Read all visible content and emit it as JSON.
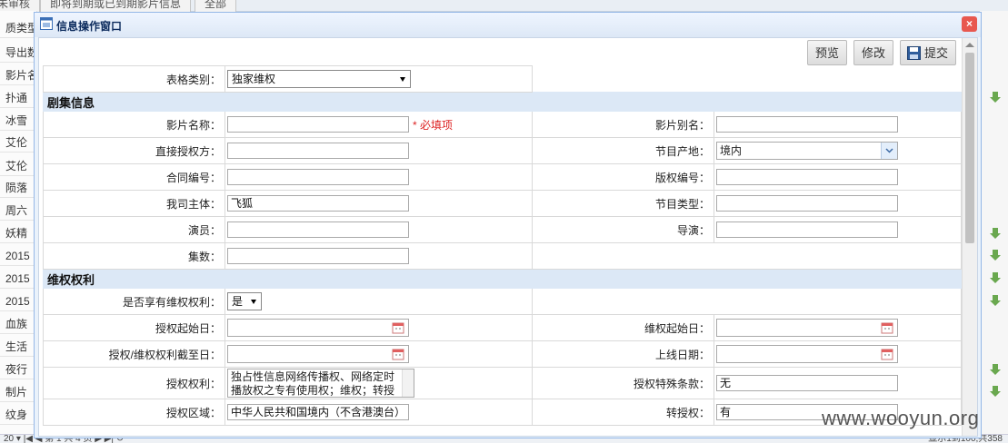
{
  "background": {
    "tabs": [
      "未审核",
      "即将到期或已到期影片信息",
      "全部"
    ],
    "left_rows": [
      "质类型",
      "导出数",
      "影片名",
      "扑通",
      "冰雪",
      "艾伦",
      "艾伦",
      "陨落",
      "周六",
      "妖精",
      "2015",
      "2015",
      "2015",
      "血族",
      "生活",
      "夜行",
      "制片",
      "纹身"
    ],
    "pager_left": "20 ▾  |◀  ◀  第 1  共 4 页  ▶  ▶|  ↻",
    "pager_right": "显示1到100,共358"
  },
  "dialog": {
    "title": "信息操作窗口",
    "close_icon": "×",
    "toolbar": {
      "preview": "预览",
      "edit": "修改",
      "submit": "提交"
    },
    "form": {
      "table_type_label": "表格类别：",
      "table_type_value": "独家维权",
      "sections": {
        "series": "剧集信息",
        "rights": "维权权利"
      },
      "fields": {
        "title_label": "影片名称：",
        "title_required": "* 必填项",
        "alias_label": "影片别名：",
        "direct_licensor_label": "直接授权方：",
        "origin_label": "节目产地：",
        "origin_value": "境内",
        "contract_label": "合同编号：",
        "copyright_label": "版权编号：",
        "entity_label": "我司主体：",
        "entity_value": "飞狐",
        "program_type_label": "节目类型：",
        "actors_label": "演员：",
        "director_label": "导演：",
        "episodes_label": "集数：",
        "enjoy_rights_label": "是否享有维权权利：",
        "enjoy_rights_value": "是",
        "license_start_label": "授权起始日：",
        "rights_start_label": "维权起始日：",
        "license_end_label": "授权/维权权利截至日：",
        "online_date_label": "上线日期：",
        "license_rights_label": "授权权利：",
        "license_rights_value": "独占性信息网络传播权、网络定时播放权之专有使用权；维权；转授",
        "special_terms_label": "授权特殊条款：",
        "special_terms_value": "无",
        "region_label": "授权区域：",
        "region_value": "中华人民共和国境内（不含港澳台）",
        "sublicense_label": "转授权：",
        "sublicense_value": "有"
      }
    }
  },
  "watermark": "www.wooyun.org"
}
